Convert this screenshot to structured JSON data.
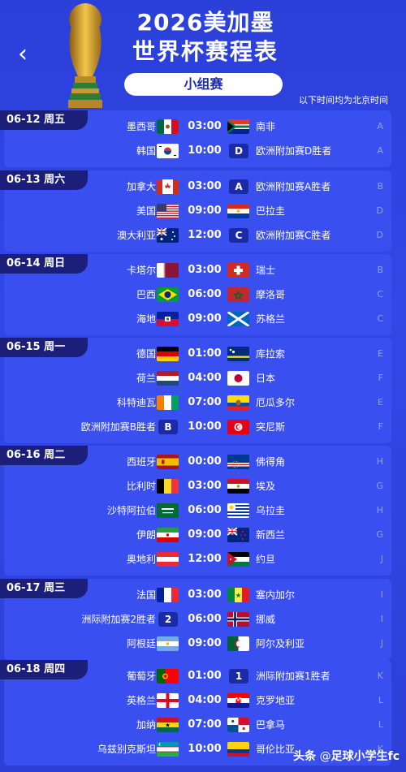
{
  "header": {
    "back_label": "‹",
    "title_line1": "2026美加墨",
    "title_line2": "世界杯赛程表",
    "stage_pill": "小组赛",
    "timezone_note": "以下时间均为北京时间"
  },
  "days": [
    {
      "date": "06-12 周五",
      "matches": [
        {
          "home": "墨西哥",
          "time": "03:00",
          "away": "南非",
          "group": "A",
          "home_flag": "mexico",
          "away_flag": "south-africa"
        },
        {
          "home": "韩国",
          "time": "10:00",
          "away": "欧洲附加赛D胜者",
          "group": "A",
          "home_flag": "korea",
          "away_badge": "D"
        }
      ]
    },
    {
      "date": "06-13 周六",
      "matches": [
        {
          "home": "加拿大",
          "time": "03:00",
          "away": "欧洲附加赛A胜者",
          "group": "B",
          "home_flag": "canada",
          "away_badge": "A"
        },
        {
          "home": "美国",
          "time": "09:00",
          "away": "巴拉圭",
          "group": "D",
          "home_flag": "usa",
          "away_flag": "paraguay"
        },
        {
          "home": "澳大利亚",
          "time": "12:00",
          "away": "欧洲附加赛C胜者",
          "group": "D",
          "home_flag": "australia",
          "away_badge": "C"
        }
      ]
    },
    {
      "date": "06-14 周日",
      "matches": [
        {
          "home": "卡塔尔",
          "time": "03:00",
          "away": "瑞士",
          "group": "B",
          "home_flag": "qatar",
          "away_flag": "switzerland"
        },
        {
          "home": "巴西",
          "time": "06:00",
          "away": "摩洛哥",
          "group": "C",
          "home_flag": "brazil",
          "away_flag": "morocco"
        },
        {
          "home": "海地",
          "time": "09:00",
          "away": "苏格兰",
          "group": "C",
          "home_flag": "haiti",
          "away_flag": "scotland"
        }
      ]
    },
    {
      "date": "06-15 周一",
      "matches": [
        {
          "home": "德国",
          "time": "01:00",
          "away": "库拉索",
          "group": "E",
          "home_flag": "germany",
          "away_flag": "curacao"
        },
        {
          "home": "荷兰",
          "time": "04:00",
          "away": "日本",
          "group": "F",
          "home_flag": "netherlands",
          "away_flag": "japan"
        },
        {
          "home": "科特迪瓦",
          "time": "07:00",
          "away": "厄瓜多尔",
          "group": "E",
          "home_flag": "ivory-coast",
          "away_flag": "ecuador"
        },
        {
          "home": "欧洲附加赛B胜者",
          "time": "10:00",
          "away": "突尼斯",
          "group": "F",
          "home_badge": "B",
          "away_flag": "tunisia"
        }
      ]
    },
    {
      "date": "06-16 周二",
      "matches": [
        {
          "home": "西班牙",
          "time": "00:00",
          "away": "佛得角",
          "group": "H",
          "home_flag": "spain",
          "away_flag": "cape-verde"
        },
        {
          "home": "比利时",
          "time": "03:00",
          "away": "埃及",
          "group": "G",
          "home_flag": "belgium",
          "away_flag": "egypt"
        },
        {
          "home": "沙特阿拉伯",
          "time": "06:00",
          "away": "乌拉圭",
          "group": "H",
          "home_flag": "saudi",
          "away_flag": "uruguay"
        },
        {
          "home": "伊朗",
          "time": "09:00",
          "away": "新西兰",
          "group": "G",
          "home_flag": "iran",
          "away_flag": "new-zealand"
        },
        {
          "home": "奥地利",
          "time": "12:00",
          "away": "约旦",
          "group": "J",
          "home_flag": "austria",
          "away_flag": "jordan"
        }
      ]
    },
    {
      "date": "06-17 周三",
      "matches": [
        {
          "home": "法国",
          "time": "03:00",
          "away": "塞内加尔",
          "group": "I",
          "home_flag": "france",
          "away_flag": "senegal"
        },
        {
          "home": "洲际附加赛2胜者",
          "time": "06:00",
          "away": "挪威",
          "group": "I",
          "home_badge": "2",
          "away_flag": "norway"
        },
        {
          "home": "阿根廷",
          "time": "09:00",
          "away": "阿尔及利亚",
          "group": "J",
          "home_flag": "argentina",
          "away_flag": "algeria"
        }
      ]
    },
    {
      "date": "06-18 周四",
      "matches": [
        {
          "home": "葡萄牙",
          "time": "01:00",
          "away": "洲际附加赛1胜者",
          "group": "K",
          "home_flag": "portugal",
          "away_badge": "1"
        },
        {
          "home": "英格兰",
          "time": "04:00",
          "away": "克罗地亚",
          "group": "L",
          "home_flag": "england",
          "away_flag": "croatia"
        },
        {
          "home": "加纳",
          "time": "07:00",
          "away": "巴拿马",
          "group": "L",
          "home_flag": "ghana",
          "away_flag": "panama"
        },
        {
          "home": "乌兹别克斯坦",
          "time": "10:00",
          "away": "哥伦比亚",
          "group": "K",
          "home_flag": "uzbekistan",
          "away_flag": "colombia"
        }
      ]
    }
  ],
  "footer": {
    "watermark": "足球小学生fc",
    "watermark_prefix": "头条"
  }
}
